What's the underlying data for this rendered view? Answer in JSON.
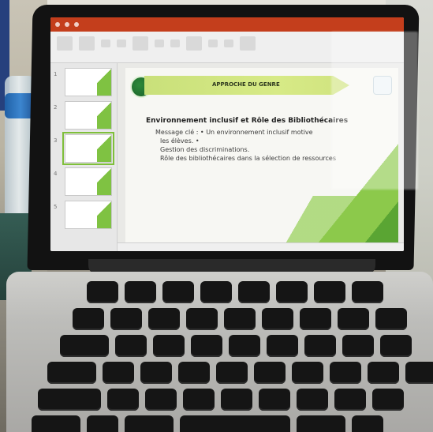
{
  "app": {
    "window_title": ""
  },
  "slide": {
    "banner_text": "APPROCHE DU GENRE",
    "heading": "Environnement inclusif et Rôle des Bibliothécaires",
    "bullets": [
      "Message clé : • Un environnement inclusif motive",
      "les élèves. •",
      "Gestion des discriminations.",
      "Rôle des bibliothécaires dans la sélection de ressources"
    ]
  },
  "thumbnails": [
    {
      "num": "1"
    },
    {
      "num": "2"
    },
    {
      "num": "3"
    },
    {
      "num": "4"
    },
    {
      "num": "5"
    }
  ],
  "colors": {
    "powerpoint_red": "#c43e1c",
    "accent_green": "#7fc242"
  }
}
